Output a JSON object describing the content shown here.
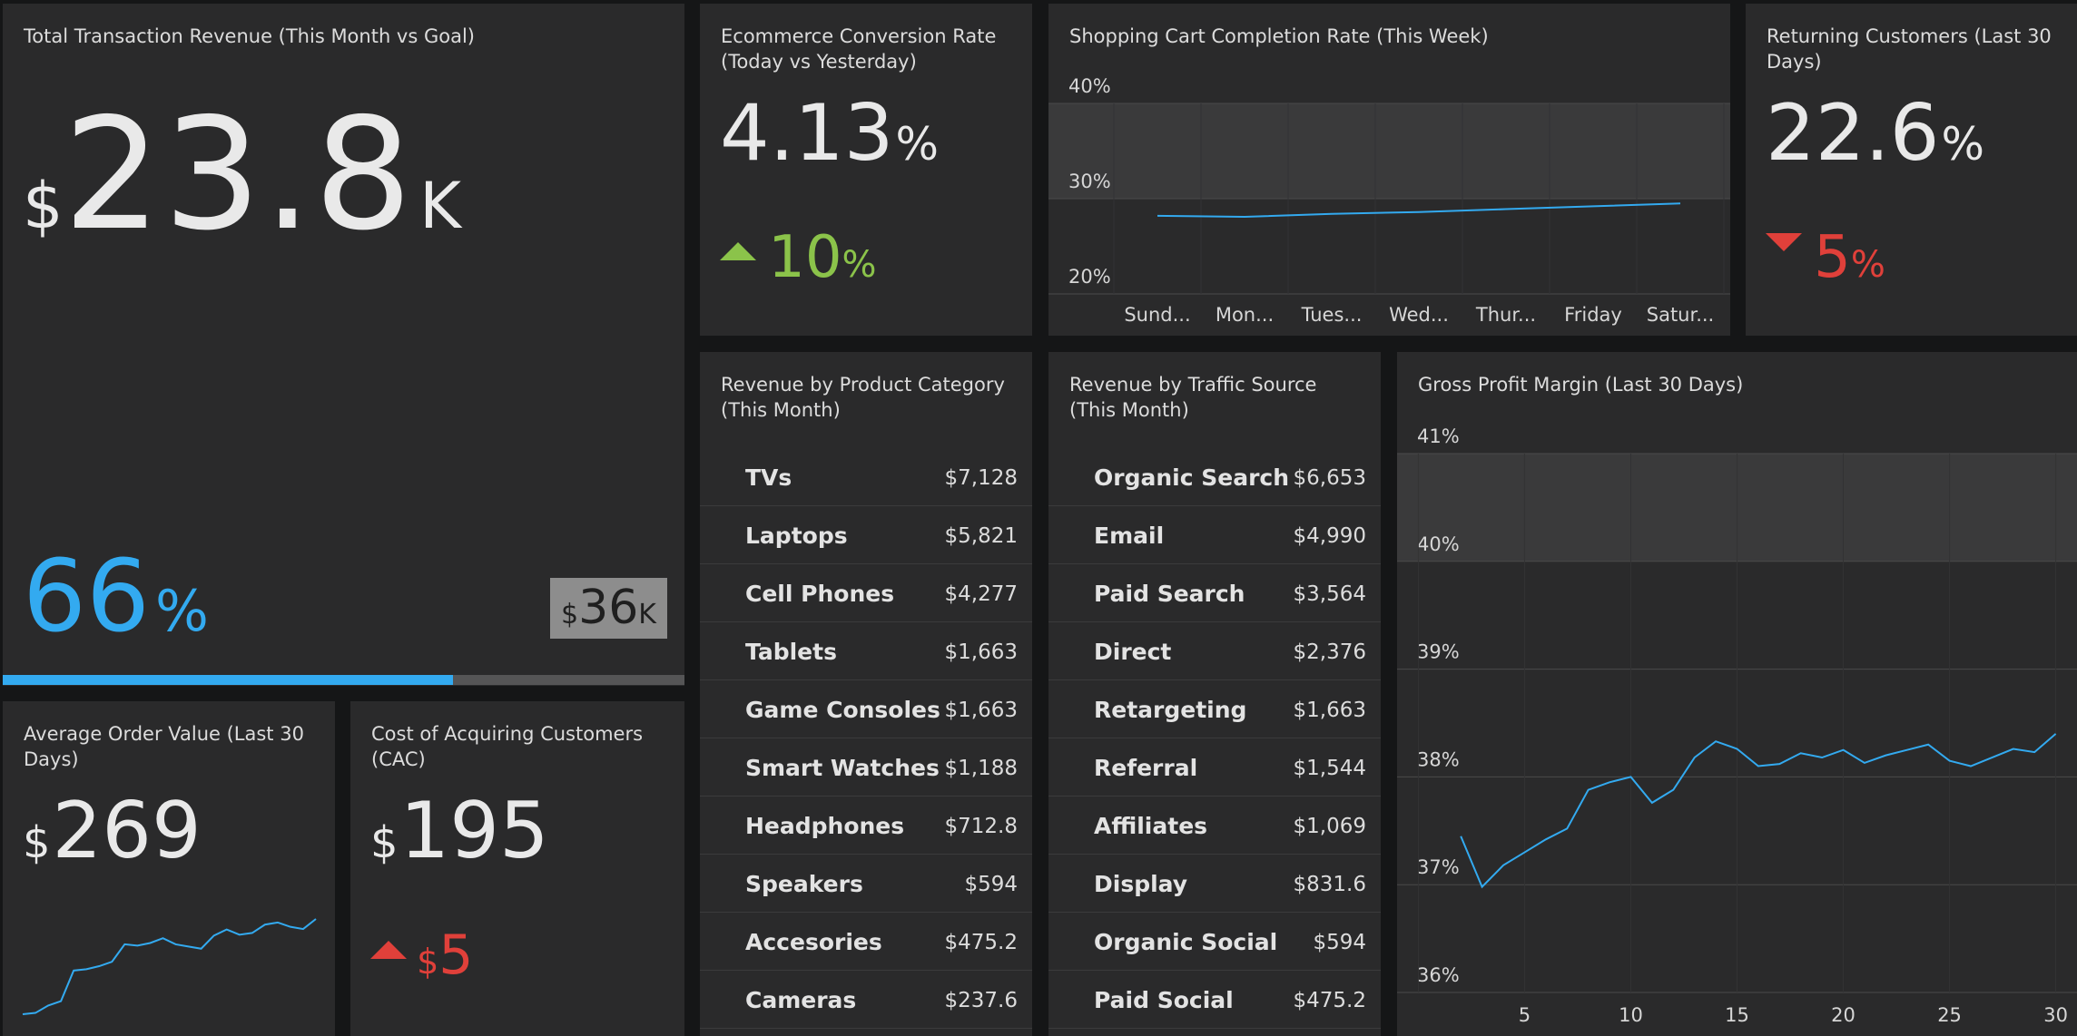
{
  "colors": {
    "accent_blue": "#33aaf0",
    "green": "#8bc34a",
    "red": "#e0403a",
    "tile": "#2a2a2b",
    "background": "#151617"
  },
  "revenue": {
    "title": "Total Transaction Revenue (This Month vs Goal)",
    "currency": "$",
    "value": "23.8",
    "suffix": "K",
    "percent": "66",
    "percent_unit": "%",
    "goal_currency": "$",
    "goal_value": "36",
    "goal_suffix": "K",
    "progress": 0.66
  },
  "conversion": {
    "title": "Ecommerce Conversion Rate (Today vs Yesterday)",
    "value": "4.13",
    "unit": "%",
    "change": "10",
    "change_unit": "%",
    "direction": "up"
  },
  "cart_completion": {
    "title": "Shopping Cart Completion Rate (This Week)",
    "chart_data": {
      "type": "line",
      "categories": [
        "Sund...",
        "Mon...",
        "Tues...",
        "Wed...",
        "Thur...",
        "Friday",
        "Satur..."
      ],
      "values": [
        28.2,
        28.1,
        28.4,
        28.6,
        28.9,
        29.2,
        29.5
      ],
      "ylim": [
        20,
        40
      ],
      "yticks": [
        "20%",
        "30%",
        "40%"
      ],
      "goal_band": [
        30,
        40
      ]
    }
  },
  "returning": {
    "title": "Returning Customers (Last 30 Days)",
    "value": "22.6",
    "unit": "%",
    "change": "5",
    "change_unit": "%",
    "direction": "down"
  },
  "aov": {
    "title": "Average Order Value (Last 30 Days)",
    "currency": "$",
    "value": "269",
    "chart_data": {
      "type": "line",
      "values": [
        1,
        1.3,
        3,
        4,
        11,
        11.3,
        12,
        13,
        17,
        16.7,
        17.3,
        18.4,
        17,
        16.5,
        16,
        19,
        20.4,
        19.2,
        19.6,
        21.5,
        22,
        21,
        20.5,
        22.8
      ]
    }
  },
  "cac": {
    "title": "Cost of Acquiring Customers (CAC)",
    "currency": "$",
    "value": "195",
    "change_currency": "$",
    "change": "5",
    "direction": "up"
  },
  "category": {
    "title": "Revenue by Product Category (This Month)",
    "rows": [
      {
        "name": "TVs",
        "value": "$7,128"
      },
      {
        "name": "Laptops",
        "value": "$5,821"
      },
      {
        "name": "Cell Phones",
        "value": "$4,277"
      },
      {
        "name": "Tablets",
        "value": "$1,663"
      },
      {
        "name": "Game Consoles",
        "value": "$1,663"
      },
      {
        "name": "Smart Watches",
        "value": "$1,188"
      },
      {
        "name": "Headphones",
        "value": "$712.8"
      },
      {
        "name": "Speakers",
        "value": "$594"
      },
      {
        "name": "Accesories",
        "value": "$475.2"
      },
      {
        "name": "Cameras",
        "value": "$237.6"
      }
    ]
  },
  "traffic": {
    "title": "Revenue by Traffic Source (This Month)",
    "rows": [
      {
        "name": "Organic Search",
        "value": "$6,653"
      },
      {
        "name": "Email",
        "value": "$4,990"
      },
      {
        "name": "Paid Search",
        "value": "$3,564"
      },
      {
        "name": "Direct",
        "value": "$2,376"
      },
      {
        "name": "Retargeting",
        "value": "$1,663"
      },
      {
        "name": "Referral",
        "value": "$1,544"
      },
      {
        "name": "Affiliates",
        "value": "$1,069"
      },
      {
        "name": "Display",
        "value": "$831.6"
      },
      {
        "name": "Organic Social",
        "value": "$594"
      },
      {
        "name": "Paid Social",
        "value": "$475.2"
      }
    ]
  },
  "margin": {
    "title": "Gross Profit Margin (Last 30 Days)",
    "chart_data": {
      "type": "line",
      "x": [
        2,
        3,
        4,
        5,
        6,
        7,
        8,
        9,
        10,
        11,
        12,
        13,
        14,
        15,
        16,
        17,
        18,
        19,
        20,
        21,
        22,
        23,
        24,
        25,
        26,
        27,
        28,
        29,
        30
      ],
      "values": [
        37.45,
        36.98,
        37.18,
        37.3,
        37.42,
        37.52,
        37.88,
        37.95,
        38.0,
        37.76,
        37.88,
        38.18,
        38.33,
        38.26,
        38.1,
        38.12,
        38.22,
        38.18,
        38.25,
        38.13,
        38.2,
        38.25,
        38.3,
        38.15,
        38.1,
        38.18,
        38.26,
        38.23,
        38.4
      ],
      "ylim": [
        36,
        41
      ],
      "yticks": [
        "36%",
        "37%",
        "38%",
        "39%",
        "40%",
        "41%"
      ],
      "xticks": [
        "5",
        "10",
        "15",
        "20",
        "25",
        "30"
      ],
      "xlim": [
        -1,
        31
      ],
      "goal_band": [
        40,
        41
      ]
    }
  }
}
